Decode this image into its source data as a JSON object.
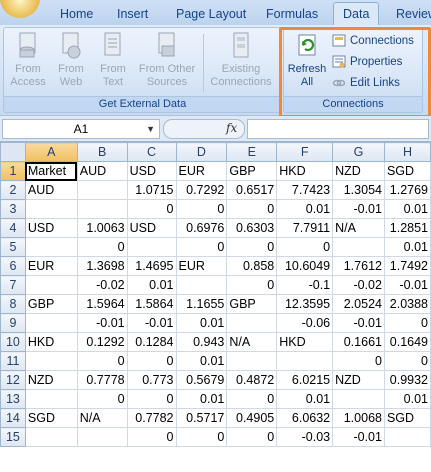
{
  "tabs": [
    {
      "label": "Home",
      "active": false
    },
    {
      "label": "Insert",
      "active": false
    },
    {
      "label": "Page Layout",
      "active": false
    },
    {
      "label": "Formulas",
      "active": false
    },
    {
      "label": "Data",
      "active": true
    },
    {
      "label": "Review",
      "active": false
    }
  ],
  "ribbon": {
    "get_external_data": {
      "label": "Get External Data",
      "buttons": [
        {
          "label": "From Access",
          "icon": "access-db-icon"
        },
        {
          "label": "From Web",
          "icon": "web-icon"
        },
        {
          "label": "From Text",
          "icon": "text-file-icon"
        },
        {
          "label": "From Other Sources",
          "icon": "other-sources-icon"
        },
        {
          "label": "Existing Connections",
          "icon": "existing-connections-icon"
        }
      ]
    },
    "connections": {
      "label": "Connections",
      "refresh_all": "Refresh All",
      "connections_btn": "Connections",
      "properties_btn": "Properties",
      "edit_links_btn": "Edit Links"
    }
  },
  "formula_bar": {
    "name_box": "A1",
    "fx": "fx",
    "formula": ""
  },
  "grid": {
    "columns": [
      "A",
      "B",
      "C",
      "D",
      "E",
      "F",
      "G",
      "H"
    ],
    "selected_column": "A",
    "selected_row": 1,
    "rows": [
      {
        "n": 1,
        "cells": [
          "Market",
          "AUD",
          "USD",
          "EUR",
          "GBP",
          "HKD",
          "NZD",
          "SGD"
        ]
      },
      {
        "n": 2,
        "cells": [
          "AUD",
          "",
          "1.0715",
          "0.7292",
          "0.6517",
          "7.7423",
          "1.3054",
          "1.2769"
        ]
      },
      {
        "n": 3,
        "cells": [
          "",
          "",
          "0",
          "0",
          "0",
          "0.01",
          "-0.01",
          "0.01"
        ]
      },
      {
        "n": 4,
        "cells": [
          "USD",
          "1.0063",
          "USD",
          "0.6976",
          "0.6303",
          "7.7911",
          "N/A",
          "1.2851"
        ]
      },
      {
        "n": 5,
        "cells": [
          "",
          "0",
          "",
          "0",
          "0",
          "0",
          "",
          "0.01"
        ]
      },
      {
        "n": 6,
        "cells": [
          "EUR",
          "1.3698",
          "1.4695",
          "EUR",
          "0.858",
          "10.6049",
          "1.7612",
          "1.7492"
        ]
      },
      {
        "n": 7,
        "cells": [
          "",
          "-0.02",
          "0.01",
          "",
          "0",
          "-0.1",
          "-0.02",
          "-0.01"
        ]
      },
      {
        "n": 8,
        "cells": [
          "GBP",
          "1.5964",
          "1.5864",
          "1.1655",
          "GBP",
          "12.3595",
          "2.0524",
          "2.0388"
        ]
      },
      {
        "n": 9,
        "cells": [
          "",
          "-0.01",
          "-0.01",
          "0.01",
          "",
          "-0.06",
          "-0.01",
          "0"
        ]
      },
      {
        "n": 10,
        "cells": [
          "HKD",
          "0.1292",
          "0.1284",
          "0.943",
          "N/A",
          "HKD",
          "0.1661",
          "0.1649"
        ]
      },
      {
        "n": 11,
        "cells": [
          "",
          "0",
          "0",
          "0.01",
          "",
          "",
          "0",
          "0"
        ]
      },
      {
        "n": 12,
        "cells": [
          "NZD",
          "0.7778",
          "0.773",
          "0.5679",
          "0.4872",
          "6.0215",
          "NZD",
          "0.9932"
        ]
      },
      {
        "n": 13,
        "cells": [
          "",
          "0",
          "0",
          "0.01",
          "0",
          "0.01",
          "",
          "0.01"
        ]
      },
      {
        "n": 14,
        "cells": [
          "SGD",
          "N/A",
          "0.7782",
          "0.5717",
          "0.4905",
          "6.0632",
          "1.0068",
          "SGD"
        ]
      },
      {
        "n": 15,
        "cells": [
          "",
          "",
          "0",
          "0",
          "0",
          "-0.03",
          "-0.01",
          ""
        ]
      }
    ]
  }
}
